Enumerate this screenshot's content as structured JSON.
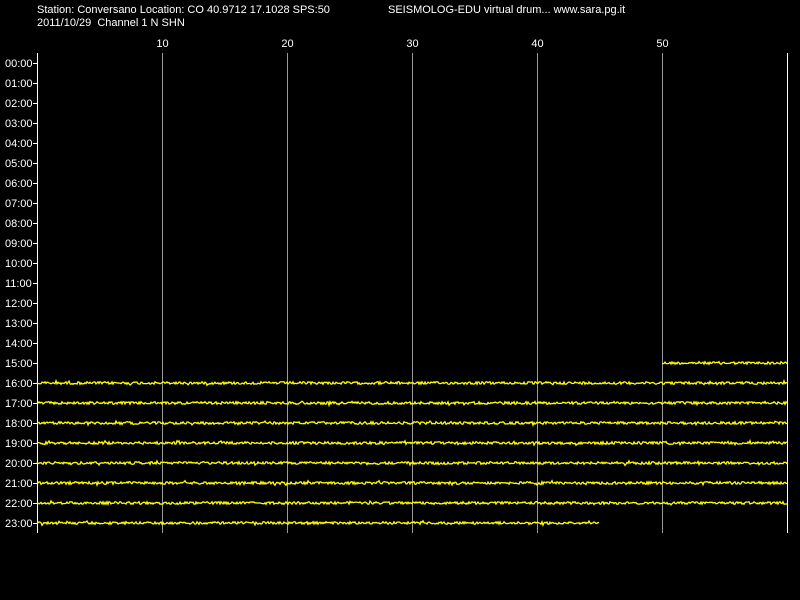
{
  "header": {
    "station_line": "Station: Conversano Location: CO 40.9712 17.1028 SPS:50",
    "credit_line": "SEISMOLOG-EDU virtual drum... www.sara.pg.it",
    "date_line": "2011/10/29  Channel 1 N SHN"
  },
  "colors": {
    "background": "#000000",
    "trace": "#ffff00",
    "grid": "#9a9a9a",
    "axis": "#ffffff",
    "text": "#ffffff"
  },
  "chart_data": {
    "type": "line",
    "title": "",
    "xlabel": "",
    "ylabel": "",
    "xlim": [
      0,
      60
    ],
    "xticks": [
      10,
      20,
      30,
      40,
      50
    ],
    "xtick_labels": [
      "10",
      "20",
      "30",
      "40",
      "50"
    ],
    "grid": true,
    "rows": [
      "00:00",
      "01:00",
      "02:00",
      "03:00",
      "04:00",
      "05:00",
      "06:00",
      "07:00",
      "08:00",
      "09:00",
      "10:00",
      "11:00",
      "12:00",
      "13:00",
      "14:00",
      "15:00",
      "16:00",
      "17:00",
      "18:00",
      "19:00",
      "20:00",
      "21:00",
      "22:00",
      "23:00"
    ],
    "traces": [
      {
        "row": "15:00",
        "start_min": 50,
        "end_min": 60
      },
      {
        "row": "16:00",
        "start_min": 0,
        "end_min": 60
      },
      {
        "row": "17:00",
        "start_min": 0,
        "end_min": 60
      },
      {
        "row": "18:00",
        "start_min": 0,
        "end_min": 60
      },
      {
        "row": "19:00",
        "start_min": 0,
        "end_min": 60
      },
      {
        "row": "20:00",
        "start_min": 0,
        "end_min": 60
      },
      {
        "row": "21:00",
        "start_min": 0,
        "end_min": 60
      },
      {
        "row": "22:00",
        "start_min": 0,
        "end_min": 60
      },
      {
        "row": "23:00",
        "start_min": 0,
        "end_min": 45
      }
    ]
  }
}
